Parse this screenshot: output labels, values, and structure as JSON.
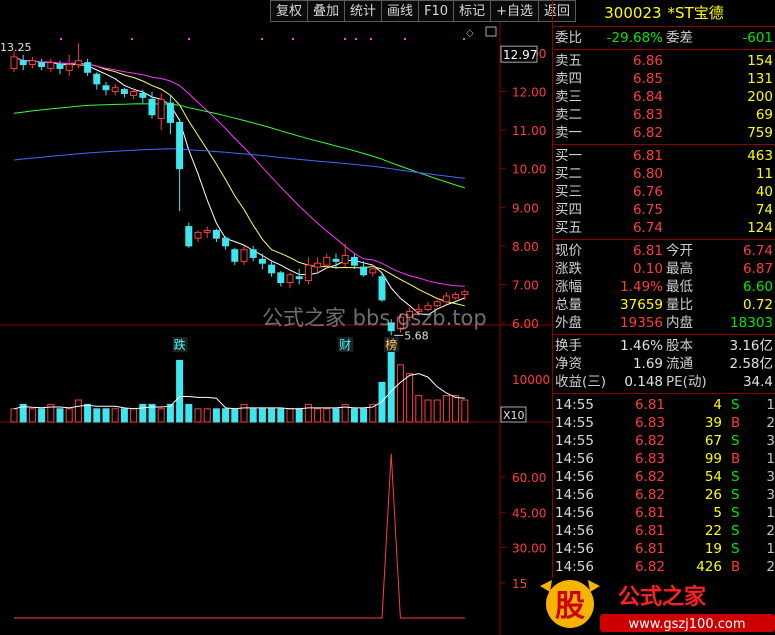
{
  "toolbar": [
    "复权",
    "叠加",
    "统计",
    "画线",
    "F10",
    "标记",
    "+自选",
    "返回"
  ],
  "chart": {
    "price_axis": [
      "13.00",
      "12.00",
      "11.00",
      "10.00",
      "9.00",
      "8.00",
      "7.00",
      "6.00"
    ],
    "current_price_tag": "12.97",
    "high_label": "13.25",
    "low_label": "5.68",
    "event_labels": [
      "跌",
      "财",
      "榜"
    ],
    "volume_axis": [
      "10000"
    ],
    "volume_multiplier": "X10",
    "indicator_axis": [
      "60.00",
      "45.00",
      "30.00",
      "15"
    ],
    "candles": [
      [
        12.6,
        12.9,
        13.05,
        12.5
      ],
      [
        12.8,
        12.7,
        12.95,
        12.55
      ],
      [
        12.7,
        12.8,
        12.9,
        12.6
      ],
      [
        12.75,
        12.65,
        12.85,
        12.55
      ],
      [
        12.6,
        12.75,
        12.85,
        12.5
      ],
      [
        12.7,
        12.6,
        12.8,
        12.45
      ],
      [
        12.55,
        12.7,
        12.95,
        12.4
      ],
      [
        12.7,
        12.8,
        13.25,
        12.6
      ],
      [
        12.75,
        12.5,
        12.85,
        12.4
      ],
      [
        12.45,
        12.2,
        12.5,
        12.05
      ],
      [
        12.15,
        12.05,
        12.25,
        11.9
      ],
      [
        12.0,
        12.1,
        12.2,
        11.9
      ],
      [
        12.05,
        11.95,
        12.1,
        11.85
      ],
      [
        11.9,
        12.0,
        12.1,
        11.8
      ],
      [
        11.95,
        11.85,
        12.05,
        11.7
      ],
      [
        11.8,
        11.4,
        12.0,
        11.3
      ],
      [
        11.3,
        11.8,
        11.95,
        11.0
      ],
      [
        11.7,
        11.2,
        11.9,
        10.9
      ],
      [
        11.2,
        10.0,
        11.3,
        8.9
      ],
      [
        8.5,
        8.0,
        8.6,
        7.95
      ],
      [
        8.2,
        8.35,
        8.4,
        8.1
      ],
      [
        8.35,
        8.4,
        8.5,
        8.2
      ],
      [
        8.4,
        8.2,
        8.45,
        8.1
      ],
      [
        8.2,
        8.0,
        8.25,
        7.9
      ],
      [
        7.9,
        7.6,
        7.95,
        7.5
      ],
      [
        7.6,
        7.9,
        8.0,
        7.5
      ],
      [
        7.9,
        7.7,
        8.0,
        7.6
      ],
      [
        7.65,
        7.55,
        7.8,
        7.4
      ],
      [
        7.5,
        7.3,
        7.6,
        7.2
      ],
      [
        7.3,
        7.05,
        7.35,
        6.95
      ],
      [
        7.05,
        7.25,
        7.3,
        6.9
      ],
      [
        7.2,
        7.15,
        7.4,
        7.0
      ],
      [
        7.1,
        7.5,
        7.7,
        7.0
      ],
      [
        7.45,
        7.55,
        7.7,
        7.3
      ],
      [
        7.5,
        7.7,
        7.8,
        7.4
      ],
      [
        7.65,
        7.6,
        7.8,
        7.4
      ],
      [
        7.55,
        7.75,
        8.05,
        7.45
      ],
      [
        7.7,
        7.5,
        7.8,
        7.4
      ],
      [
        7.45,
        7.25,
        7.6,
        7.2
      ],
      [
        7.3,
        7.4,
        7.5,
        7.2
      ],
      [
        7.2,
        6.6,
        7.3,
        6.55
      ],
      [
        6.0,
        5.8,
        6.1,
        5.68
      ],
      [
        5.85,
        6.15,
        6.25,
        5.75
      ],
      [
        6.15,
        6.3,
        6.4,
        6.05
      ],
      [
        6.3,
        6.35,
        6.5,
        6.2
      ],
      [
        6.35,
        6.45,
        6.55,
        6.3
      ],
      [
        6.45,
        6.55,
        6.6,
        6.4
      ],
      [
        6.55,
        6.7,
        6.8,
        6.5
      ],
      [
        6.65,
        6.74,
        6.8,
        6.6
      ],
      [
        6.74,
        6.81,
        6.87,
        6.6
      ]
    ],
    "volumes": [
      3,
      4,
      3,
      3,
      4,
      3,
      3,
      5,
      4,
      3,
      3,
      3,
      3,
      3,
      4,
      4,
      3,
      4,
      14,
      4,
      3,
      3,
      3,
      3,
      3,
      4,
      3,
      3,
      3,
      3,
      3,
      3,
      4,
      3,
      3,
      3,
      4,
      3,
      3,
      4,
      9,
      16,
      13,
      11,
      6,
      5,
      5,
      6,
      6,
      5
    ],
    "indicator": [
      0,
      0,
      0,
      0,
      0,
      0,
      0,
      0,
      0,
      0,
      0,
      0,
      0,
      0,
      0,
      0,
      0,
      0,
      0,
      0,
      0,
      0,
      0,
      0,
      0,
      0,
      0,
      0,
      0,
      0,
      0,
      0,
      0,
      0,
      0,
      0,
      0,
      0,
      0,
      0,
      0,
      70,
      0,
      0,
      0,
      0,
      0,
      0,
      0,
      0
    ]
  },
  "quote": {
    "code": "300023",
    "name": "*ST宝德",
    "weibi_label": "委比",
    "weibi": "-29.68%",
    "weicha_label": "委差",
    "weicha": "-601",
    "sells": [
      {
        "label": "卖五",
        "price": "6.86",
        "vol": "154"
      },
      {
        "label": "卖四",
        "price": "6.85",
        "vol": "131"
      },
      {
        "label": "卖三",
        "price": "6.84",
        "vol": "200"
      },
      {
        "label": "卖二",
        "price": "6.83",
        "vol": "69"
      },
      {
        "label": "卖一",
        "price": "6.82",
        "vol": "759"
      }
    ],
    "buys": [
      {
        "label": "买一",
        "price": "6.81",
        "vol": "463"
      },
      {
        "label": "买二",
        "price": "6.80",
        "vol": "11"
      },
      {
        "label": "买三",
        "price": "6.76",
        "vol": "40"
      },
      {
        "label": "买四",
        "price": "6.75",
        "vol": "74"
      },
      {
        "label": "买五",
        "price": "6.74",
        "vol": "124"
      }
    ],
    "stats": [
      {
        "l1": "现价",
        "v1": "6.81",
        "c1": "red",
        "l2": "今开",
        "v2": "6.74",
        "c2": "red"
      },
      {
        "l1": "涨跌",
        "v1": "0.10",
        "c1": "red",
        "l2": "最高",
        "v2": "6.87",
        "c2": "red"
      },
      {
        "l1": "涨幅",
        "v1": "1.49%",
        "c1": "red",
        "l2": "最低",
        "v2": "6.60",
        "c2": "grn"
      },
      {
        "l1": "总量",
        "v1": "37659",
        "c1": "yel",
        "l2": "量比",
        "v2": "0.72",
        "c2": "yel"
      },
      {
        "l1": "外盘",
        "v1": "19356",
        "c1": "red",
        "l2": "内盘",
        "v2": "18303",
        "c2": "grn"
      }
    ],
    "fin": [
      {
        "l1": "换手",
        "v1": "1.46%",
        "l2": "股本",
        "v2": "3.16亿"
      },
      {
        "l1": "净资",
        "v1": "1.69",
        "l2": "流通",
        "v2": "2.58亿"
      },
      {
        "l1": "收益(三)",
        "v1": "0.148",
        "l2": "PE(动)",
        "v2": "34.4"
      }
    ],
    "ticks": [
      {
        "t": "14:55",
        "p": "6.81",
        "q": "4",
        "s": "S",
        "n": "1"
      },
      {
        "t": "14:55",
        "p": "6.83",
        "q": "39",
        "s": "B",
        "n": "2"
      },
      {
        "t": "14:55",
        "p": "6.82",
        "q": "67",
        "s": "S",
        "n": "3"
      },
      {
        "t": "14:56",
        "p": "6.83",
        "q": "99",
        "s": "B",
        "n": "1"
      },
      {
        "t": "14:56",
        "p": "6.82",
        "q": "54",
        "s": "S",
        "n": "3"
      },
      {
        "t": "14:56",
        "p": "6.82",
        "q": "26",
        "s": "S",
        "n": "3"
      },
      {
        "t": "14:56",
        "p": "6.81",
        "q": "5",
        "s": "S",
        "n": "1"
      },
      {
        "t": "14:56",
        "p": "6.81",
        "q": "22",
        "s": "S",
        "n": "2"
      },
      {
        "t": "14:56",
        "p": "6.81",
        "q": "19",
        "s": "S",
        "n": "1"
      },
      {
        "t": "14:56",
        "p": "6.82",
        "q": "426",
        "s": "B",
        "n": "2"
      }
    ]
  },
  "watermarks": {
    "center": "公式之家 bbs.gszb.top",
    "brand_big": "公式之家",
    "brand_char": "股",
    "brand_url": "www.gszj100.com"
  },
  "colors": {
    "up": "#ff3c3c",
    "down": "#3ee6f0",
    "frame": "#8b0000",
    "ma5": "#ffffff",
    "ma10": "#ffff66",
    "ma20": "#ff33ff",
    "ma60": "#33ff33",
    "ma120": "#4466ff"
  }
}
